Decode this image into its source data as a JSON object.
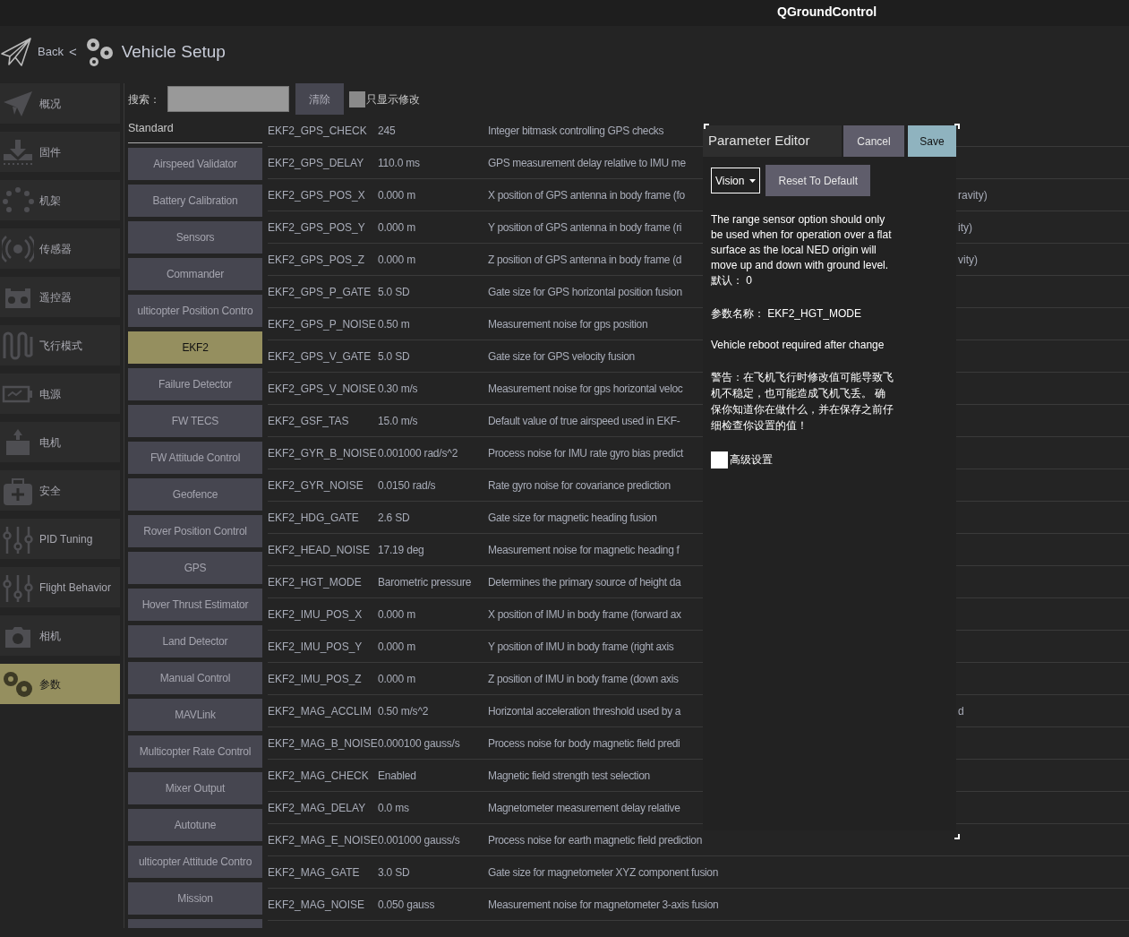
{
  "title_bar": {
    "title": "QGroundControl"
  },
  "toolbar": {
    "back": "Back",
    "separator": "<",
    "title": "Vehicle Setup"
  },
  "sidebar": {
    "items": [
      {
        "label": "概况",
        "selected": false
      },
      {
        "label": "固件",
        "selected": false
      },
      {
        "label": "机架",
        "selected": false
      },
      {
        "label": "传感器",
        "selected": false
      },
      {
        "label": "遥控器",
        "selected": false
      },
      {
        "label": "飞行模式",
        "selected": false
      },
      {
        "label": "电源",
        "selected": false
      },
      {
        "label": "电机",
        "selected": false
      },
      {
        "label": "安全",
        "selected": false
      },
      {
        "label": "PID Tuning",
        "selected": false
      },
      {
        "label": "Flight Behavior",
        "selected": false
      },
      {
        "label": "相机",
        "selected": false
      },
      {
        "label": "参数",
        "selected": true
      }
    ]
  },
  "search": {
    "label": "搜索：",
    "clear_button": "清除",
    "modified_only": {
      "label": "只显示修改",
      "checked": false
    }
  },
  "groups": {
    "header": "Standard",
    "items": [
      {
        "label": "Airspeed Validator",
        "selected": false
      },
      {
        "label": "Battery Calibration",
        "selected": false
      },
      {
        "label": "Sensors",
        "selected": false
      },
      {
        "label": "Commander",
        "selected": false
      },
      {
        "label": "ulticopter Position Contro",
        "selected": false
      },
      {
        "label": "EKF2",
        "selected": true
      },
      {
        "label": "Failure Detector",
        "selected": false
      },
      {
        "label": "FW TECS",
        "selected": false
      },
      {
        "label": "FW Attitude Control",
        "selected": false
      },
      {
        "label": "Geofence",
        "selected": false
      },
      {
        "label": "Rover Position Control",
        "selected": false
      },
      {
        "label": "GPS",
        "selected": false
      },
      {
        "label": "Hover Thrust Estimator",
        "selected": false
      },
      {
        "label": "Land Detector",
        "selected": false
      },
      {
        "label": "Manual Control",
        "selected": false
      },
      {
        "label": "MAVLink",
        "selected": false
      },
      {
        "label": "Multicopter Rate Control",
        "selected": false
      },
      {
        "label": "Mixer Output",
        "selected": false
      },
      {
        "label": "Autotune",
        "selected": false
      },
      {
        "label": "ulticopter Attitude Contro",
        "selected": false
      },
      {
        "label": "Mission",
        "selected": false
      }
    ]
  },
  "parameters": {
    "rows": [
      {
        "name": "EKF2_GPS_CHECK",
        "value": "245",
        "description": "Integer bitmask controlling GPS checks"
      },
      {
        "name": "EKF2_GPS_DELAY",
        "value": "110.0 ms",
        "description": "GPS measurement delay relative to IMU me"
      },
      {
        "name": "EKF2_GPS_POS_X",
        "value": "0.000 m",
        "description": "X position of GPS antenna in body frame (fo",
        "description_tail": "ravity)"
      },
      {
        "name": "EKF2_GPS_POS_Y",
        "value": "0.000 m",
        "description": "Y position of GPS antenna in body frame (ri",
        "description_tail": "ity)"
      },
      {
        "name": "EKF2_GPS_POS_Z",
        "value": "0.000 m",
        "description": "Z position of GPS antenna in body frame (d",
        "description_tail": "vity)"
      },
      {
        "name": "EKF2_GPS_P_GATE",
        "value": "5.0 SD",
        "description": "Gate size for GPS horizontal position fusion"
      },
      {
        "name": "EKF2_GPS_P_NOISE",
        "value": "0.50 m",
        "description": "Measurement noise for gps position"
      },
      {
        "name": "EKF2_GPS_V_GATE",
        "value": "5.0 SD",
        "description": "Gate size for GPS velocity fusion"
      },
      {
        "name": "EKF2_GPS_V_NOISE",
        "value": "0.30 m/s",
        "description": "Measurement noise for gps horizontal veloc"
      },
      {
        "name": "EKF2_GSF_TAS",
        "value": "15.0 m/s",
        "description": "Default value of true airspeed used in EKF-"
      },
      {
        "name": "EKF2_GYR_B_NOISE",
        "value": "0.001000 rad/s^2",
        "description": "Process noise for IMU rate gyro bias predict"
      },
      {
        "name": "EKF2_GYR_NOISE",
        "value": "0.0150 rad/s",
        "description": "Rate gyro noise for covariance prediction"
      },
      {
        "name": "EKF2_HDG_GATE",
        "value": "2.6 SD",
        "description": "Gate size for magnetic heading fusion"
      },
      {
        "name": "EKF2_HEAD_NOISE",
        "value": "17.19 deg",
        "description": "Measurement noise for magnetic heading f"
      },
      {
        "name": "EKF2_HGT_MODE",
        "value": "Barometric pressure",
        "description": "Determines the primary source of height da"
      },
      {
        "name": "EKF2_IMU_POS_X",
        "value": "0.000 m",
        "description": "X position of IMU in body frame (forward ax"
      },
      {
        "name": "EKF2_IMU_POS_Y",
        "value": "0.000 m",
        "description": "Y position of IMU in body frame (right axis"
      },
      {
        "name": "EKF2_IMU_POS_Z",
        "value": "0.000 m",
        "description": "Z position of IMU in body frame (down axis"
      },
      {
        "name": "EKF2_MAG_ACCLIM",
        "value": "0.50 m/s^2",
        "description": "Horizontal acceleration threshold used by a",
        "description_tail": "d"
      },
      {
        "name": "EKF2_MAG_B_NOISE",
        "value": "0.000100 gauss/s",
        "description": "Process noise for body magnetic field predi"
      },
      {
        "name": "EKF2_MAG_CHECK",
        "value": "Enabled",
        "description": "Magnetic field strength test selection"
      },
      {
        "name": "EKF2_MAG_DELAY",
        "value": "0.0 ms",
        "description": "Magnetometer measurement delay relative"
      },
      {
        "name": "EKF2_MAG_E_NOISE",
        "value": "0.001000 gauss/s",
        "description": "Process noise for earth magnetic field prediction"
      },
      {
        "name": "EKF2_MAG_GATE",
        "value": "3.0 SD",
        "description": "Gate size for magnetometer XYZ component fusion"
      },
      {
        "name": "EKF2_MAG_NOISE",
        "value": "0.050 gauss",
        "description": "Measurement noise for magnetometer 3-axis fusion"
      }
    ]
  },
  "editor": {
    "title": "Parameter Editor",
    "cancel": "Cancel",
    "save": "Save",
    "value": "Vision",
    "reset": "Reset To Default",
    "description": "The range sensor option should only be used when for operation over a flat surface as the local NED origin will move up and down with ground level.",
    "default": "默认： 0",
    "param_name": "参数名称： EKF2_HGT_MODE",
    "reboot_note": "Vehicle reboot required after change",
    "warning": "警告：在飞机飞行时修改值可能导致飞机不稳定，也可能造成飞机飞丢。 确保你知道你在做什么，并在保存之前仔细检查你设置的值！",
    "advanced": {
      "label": "高级设置",
      "checked": false
    }
  }
}
